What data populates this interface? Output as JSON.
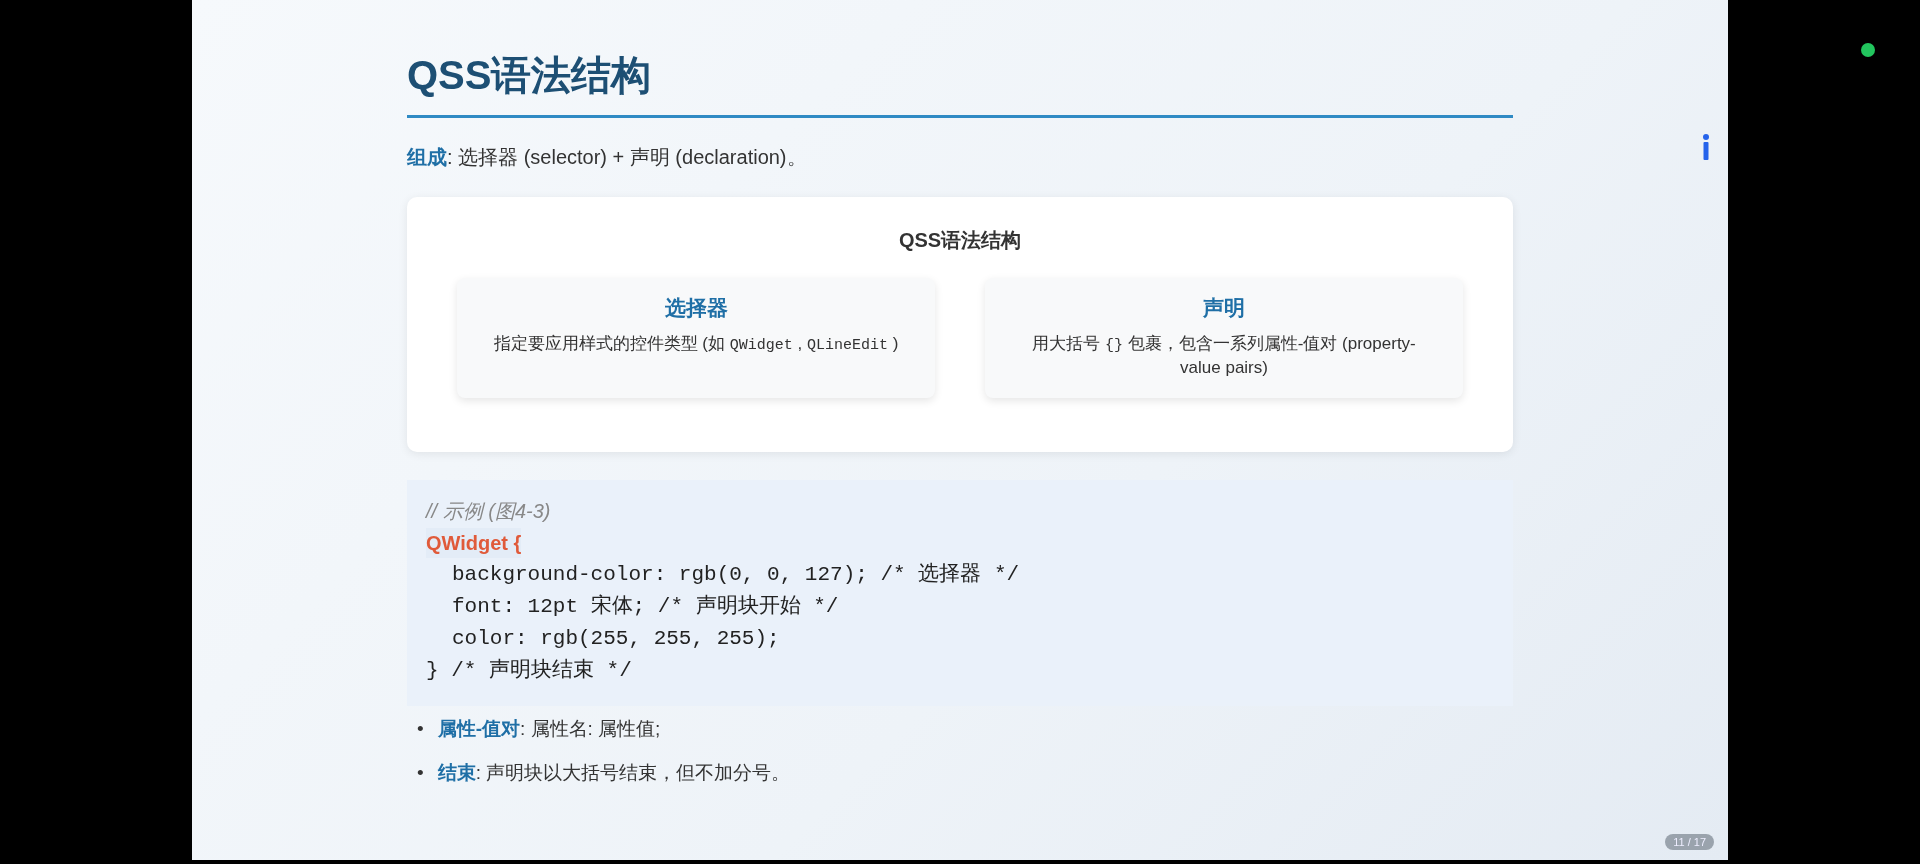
{
  "slide": {
    "title": "QSS语法结构",
    "intro": "**组成**: 选择器 (selector) + 声明 (declaration)。",
    "diagram": {
      "title": "QSS语法结构",
      "boxes": [
        {
          "heading": "选择器",
          "description": [
            {
              "kind": "text",
              "text": "指定要应用样式的控件类型 (如 "
            },
            {
              "kind": "code",
              "text": "QWidget"
            },
            {
              "kind": "text",
              "text": " , "
            },
            {
              "kind": "code",
              "text": "QLineEdit"
            },
            {
              "kind": "text",
              "text": " )"
            }
          ]
        },
        {
          "heading": "声明",
          "description": [
            {
              "kind": "text",
              "text": "用大括号 "
            },
            {
              "kind": "code",
              "text": "{}"
            },
            {
              "kind": "text",
              "text": " 包裹，包含一系列属性-值对 (property-value pairs)"
            }
          ]
        }
      ]
    },
    "code": [
      {
        "kind": "comment",
        "text": "// 示例 (图4-3)"
      },
      {
        "kind": "selector",
        "text": "QWidget {"
      },
      {
        "kind": "body",
        "text": "background-color: rgb(0, 0, 127); /* 选择器 */"
      },
      {
        "kind": "body",
        "text": "font: 12pt 宋体; /* 声明块开始 */"
      },
      {
        "kind": "body",
        "text": "color: rgb(255, 255, 255);"
      },
      {
        "kind": "close",
        "text": "} /* 声明块结束 */"
      }
    ],
    "bullets": [
      {
        "marker": "•",
        "text": "**属性-值对**: 属性名: 属性值;"
      },
      {
        "marker": "•",
        "text": "**结束**: 声明块以大括号结束，但不加分号。"
      }
    ],
    "page_counter": "11 / 17"
  }
}
